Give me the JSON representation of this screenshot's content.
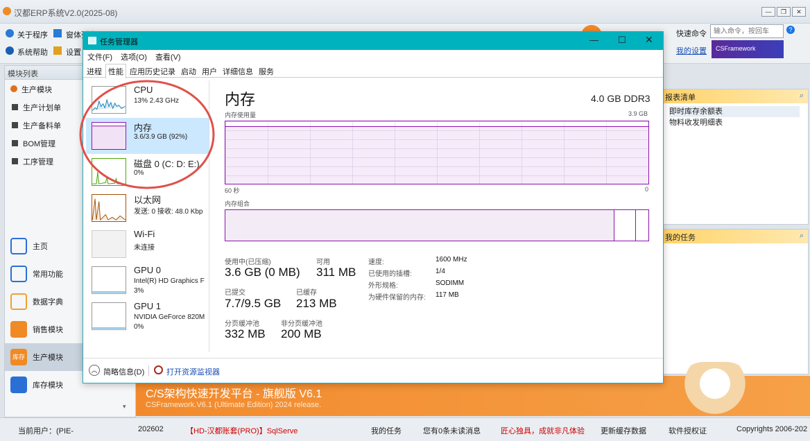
{
  "app": {
    "title": "汉都ERP系统V2.0(2025-08)",
    "window_controls": [
      "—",
      "❐",
      "✕"
    ]
  },
  "toolbar": {
    "about": "关于程序",
    "window_list": "窗体列表",
    "help": "系统帮助",
    "settings": "设置",
    "quick_cmd_label": "快速命令",
    "quick_cmd_placeholder": "输入命令，按回车",
    "my_settings": "我的设置",
    "framework_badge": "CSFramework"
  },
  "sidebar": {
    "header": "模块列表",
    "group": "生产模块",
    "items": [
      "生产计划单",
      "生产备料单",
      "BOM管理",
      "工序管理"
    ],
    "nav": [
      {
        "label": "主页",
        "active": false
      },
      {
        "label": "常用功能",
        "active": false
      },
      {
        "label": "数据字典",
        "active": false
      },
      {
        "label": "销售模块",
        "active": false
      },
      {
        "label": "生产模块",
        "active": true
      },
      {
        "label": "库存模块",
        "active": false
      }
    ],
    "active_badge": "库存"
  },
  "right_panels": {
    "report_title": "报表清单",
    "reports": [
      "即时库存余额表",
      "物料收发明细表"
    ],
    "tasks_title": "我的任务"
  },
  "banner": {
    "title": "C/S架构快速开发平台 - 旗舰版 V6.1",
    "subtitle": "CSFramework.V6.1 (Ultimate Edition) 2024 release."
  },
  "statusbar": {
    "user": "当前用户：(PIE-",
    "period": "202602",
    "db": "【HD-汉都账套(PRO)】SqlServe",
    "tasks": "我的任务",
    "messages": "您有0条未读消息",
    "slogan": "匠心独具，成就非凡体验",
    "refresh": "更新缓存数据",
    "license": "软件授权证",
    "copyright": "Copyrights 2006-202"
  },
  "taskmgr": {
    "title": "任务管理器",
    "menu": [
      "文件(F)",
      "选项(O)",
      "查看(V)"
    ],
    "tabs": [
      "进程",
      "性能",
      "应用历史记录",
      "启动",
      "用户",
      "详细信息",
      "服务"
    ],
    "active_tab": "性能",
    "perf_items": [
      {
        "name": "CPU",
        "sub": "13% 2.43 GHz",
        "color": "#117dbb"
      },
      {
        "name": "内存",
        "sub": "3.6/3.9 GB (92%)",
        "color": "#8b12ae"
      },
      {
        "name": "磁盘 0 (C: D: E:)",
        "sub": "0%",
        "color": "#4da60c"
      },
      {
        "name": "以太网",
        "sub": "发送: 0 接收: 48.0 Kbp",
        "color": "#a74f01"
      },
      {
        "name": "Wi-Fi",
        "sub": "未连接",
        "color": "#a74f01"
      },
      {
        "name": "GPU 0",
        "sub": "Intel(R) HD Graphics F",
        "sub2": "3%",
        "color": "#117dbb"
      },
      {
        "name": "GPU 1",
        "sub": "NVIDIA GeForce 820M",
        "sub2": "0%",
        "color": "#117dbb"
      }
    ],
    "detail": {
      "heading": "内存",
      "capacity": "4.0 GB DDR3",
      "usage_label": "内存使用量",
      "usage_max": "3.9 GB",
      "time_left": "60 秒",
      "time_right": "0",
      "composition_label": "内存组合",
      "usage_fraction": 0.92,
      "stats": [
        {
          "label": "使用中(已压缩)",
          "value": "3.6 GB (0 MB)"
        },
        {
          "label": "可用",
          "value": "311 MB"
        },
        {
          "label": "已提交",
          "value": "7.7/9.5 GB"
        },
        {
          "label": "已缓存",
          "value": "213 MB"
        },
        {
          "label": "分页缓冲池",
          "value": "332 MB"
        },
        {
          "label": "非分页缓冲池",
          "value": "200 MB"
        }
      ],
      "specs": [
        {
          "k": "速度:",
          "v": "1600 MHz"
        },
        {
          "k": "已使用的插槽:",
          "v": "1/4"
        },
        {
          "k": "外形规格:",
          "v": "SODIMM"
        },
        {
          "k": "为硬件保留的内存:",
          "v": "117 MB"
        }
      ]
    },
    "footer": {
      "brief": "简略信息(D)",
      "monitor": "打开资源监视器"
    }
  }
}
